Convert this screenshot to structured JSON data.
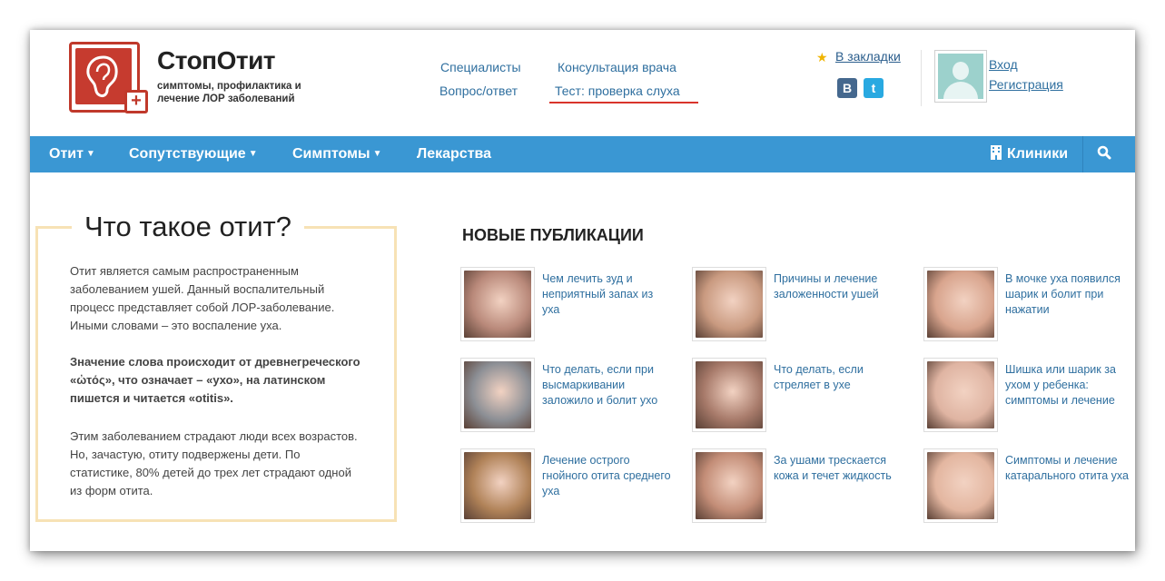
{
  "header": {
    "site_title": "СтопОтит",
    "site_tagline": "симптомы, профилактика и лечение ЛОР заболеваний",
    "top_links": {
      "specialists": "Специалисты",
      "qa": "Вопрос/ответ",
      "consultation": "Консультация врача",
      "hearing_test": "Тест: проверка слуха"
    },
    "bookmarks_label": "В закладки",
    "social": {
      "vk": "B",
      "twitter": "t"
    },
    "login_label": "Вход",
    "register_label": "Регистрация"
  },
  "nav": {
    "items": [
      "Отит",
      "Сопутствующие",
      "Симптомы",
      "Лекарства"
    ],
    "clinics_label": "Клиники"
  },
  "info_box": {
    "title": "Что такое отит?",
    "paragraphs": [
      "Отит является самым распространенным заболеванием ушей. Данный воспалительный процесс представляет собой ЛОР-заболевание. Иными словами – это воспаление уха.",
      "Значение слова происходит от древнегреческого «ὠτός», что означает – «ухо», на латинском пишется и читается «otitis».",
      "Этим заболеванием страдают люди всех возрастов. Но, зачастую, отиту подвержены дети. По статистике, 80% детей до трех лет страдают одной из форм отита."
    ]
  },
  "publications": {
    "heading": "НОВЫЕ ПУБЛИКАЦИИ",
    "items": [
      {
        "title": "Чем лечить зуд и неприятный запах из уха",
        "thumb_color": "#b9897a"
      },
      {
        "title": "Причины и лечение заложенности ушей",
        "thumb_color": "#c99a80"
      },
      {
        "title": "В мочке уха появился шарик и болит при нажатии",
        "thumb_color": "#d8a48d"
      },
      {
        "title": "Что делать, если при высмаркивании заложило и болит ухо",
        "thumb_color": "#8c8f95"
      },
      {
        "title": "Что делать, если стреляет в ухе",
        "thumb_color": "#a77a6a"
      },
      {
        "title": "Шишка или шарик за ухом у ребенка: симптомы и лечение",
        "thumb_color": "#dfb4a2"
      },
      {
        "title": "Лечение острого гнойного отита среднего уха",
        "thumb_color": "#b08258"
      },
      {
        "title": "За ушами трескается кожа и течет жидкость",
        "thumb_color": "#c38d77"
      },
      {
        "title": "Симптомы и лечение катарального отита уха",
        "thumb_color": "#e3b6a0"
      }
    ]
  },
  "colors": {
    "nav_bg": "#3a97d3",
    "accent_red": "#c63b2f",
    "link_blue": "#2f6f9f",
    "box_border": "#f7e2b5"
  }
}
